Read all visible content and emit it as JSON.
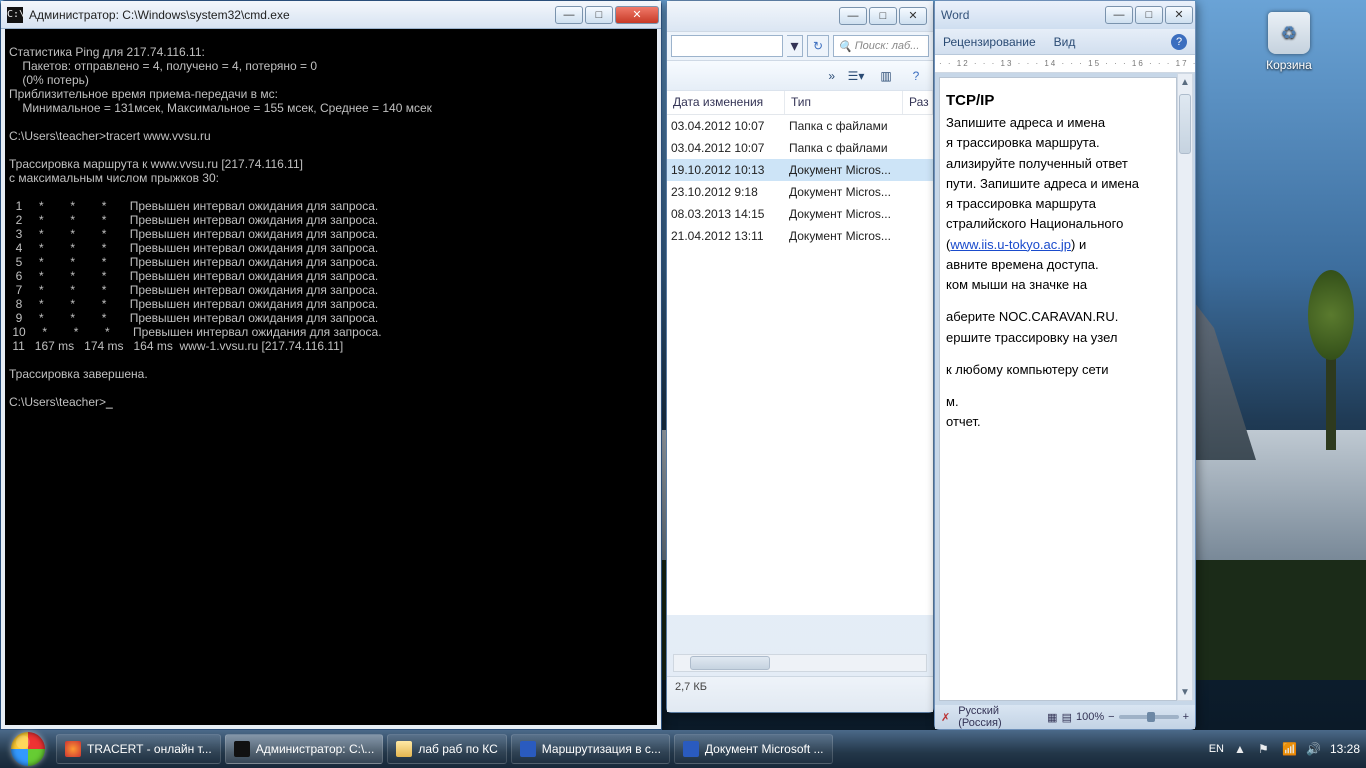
{
  "desktop": {
    "recycle_label": "Корзина"
  },
  "cmd": {
    "title": "Администратор: C:\\Windows\\system32\\cmd.exe",
    "icon_text": "C:\\",
    "body": "\nСтатистика Ping для 217.74.116.11:\n    Пакетов: отправлено = 4, получено = 4, потеряно = 0\n    (0% потерь)\nПриблизительное время приема-передачи в мс:\n    Минимальное = 131мсек, Максимальное = 155 мсек, Среднее = 140 мсек\n\nC:\\Users\\teacher>tracert www.vvsu.ru\n\nТрассировка маршрута к www.vvsu.ru [217.74.116.11]\nс максимальным числом прыжков 30:\n\n  1     *        *        *       Превышен интервал ожидания для запроса.\n  2     *        *        *       Превышен интервал ожидания для запроса.\n  3     *        *        *       Превышен интервал ожидания для запроса.\n  4     *        *        *       Превышен интервал ожидания для запроса.\n  5     *        *        *       Превышен интервал ожидания для запроса.\n  6     *        *        *       Превышен интервал ожидания для запроса.\n  7     *        *        *       Превышен интервал ожидания для запроса.\n  8     *        *        *       Превышен интервал ожидания для запроса.\n  9     *        *        *       Превышен интервал ожидания для запроса.\n 10     *        *        *       Превышен интервал ожидания для запроса.\n 11   167 ms   174 ms   164 ms  www-1.vvsu.ru [217.74.116.11]\n\nТрассировка завершена.\n\nC:\\Users\\teacher>"
  },
  "explorer": {
    "search_placeholder": "Поиск: лаб...",
    "toolbar_chevron": "»",
    "col_date": "Дата изменения",
    "col_type": "Тип",
    "col_size": "Раз",
    "rows": [
      {
        "date": "03.04.2012 10:07",
        "type": "Папка с файлами"
      },
      {
        "date": "03.04.2012 10:07",
        "type": "Папка с файлами"
      },
      {
        "date": "19.10.2012 10:13",
        "type": "Документ Micros..."
      },
      {
        "date": "23.10.2012 9:18",
        "type": "Документ Micros..."
      },
      {
        "date": "08.03.2013 14:15",
        "type": "Документ Micros..."
      },
      {
        "date": "21.04.2012 13:11",
        "type": "Документ Micros..."
      }
    ],
    "status_size": "2,7 КБ"
  },
  "word": {
    "title": "Word",
    "ribbon_review": "Рецензирование",
    "ribbon_view": "Вид",
    "ruler": "· · 12 · · · 13 · · · 14 · · · 15 · · · 16 · · · 17 · ·",
    "heading": "TCP/IP",
    "p1": "Запишите  адреса  и  имена",
    "p2_prefix": "я трассировка маршрута.",
    "p3": "ализируйте полученный  ответ",
    "p4": "пути. Запишите адреса и имена",
    "p5": "я трассировка маршрута",
    "p6": "стралийского   Национального",
    "link_text": "www.iis.u-tokyo.ac.jp",
    "p6b_pre": "(",
    "p6b_post": ")      и",
    "p7": "авните времена доступа.",
    "p8": "ком мыши на значке на",
    "p9": "аберите NOC.CARAVAN.RU.",
    "p10": "ершите  трассировку  на узел",
    "p11": "   к  любому компьютеру сети",
    "p12": "м.",
    "p13": "отчет.",
    "status_lang": "Русский (Россия)",
    "status_zoom": "100%"
  },
  "taskbar": {
    "btn_firefox": "TRACERT - онлайн т...",
    "btn_cmd": "Администратор: C:\\...",
    "btn_folder": "лаб раб по КС",
    "btn_word1": "Маршрутизация в с...",
    "btn_word2": "Документ Microsoft ...",
    "lang": "EN",
    "clock": "13:28"
  },
  "glyph": {
    "min": "—",
    "max": "□",
    "close": "✕",
    "dd": "▾",
    "up": "▲",
    "down": "▼",
    "chev": "»",
    "flag": "⚑",
    "snd": "🔊"
  }
}
